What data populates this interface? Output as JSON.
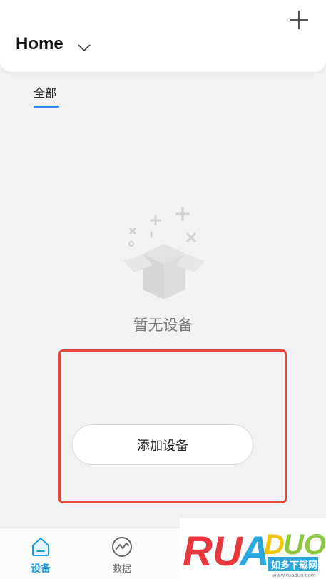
{
  "header": {
    "title": "Home"
  },
  "tabs": [
    {
      "label": "全部"
    }
  ],
  "empty_state": {
    "message": "暂无设备"
  },
  "actions": {
    "add_device_label": "添加设备"
  },
  "bottom_nav": {
    "items": [
      {
        "label": "设备",
        "icon": "home-icon",
        "active": true
      },
      {
        "label": "数据",
        "icon": "chart-pulse-icon",
        "active": false
      }
    ]
  },
  "watermark": {
    "brand": "RUADADUO",
    "tagline": "如多下载网",
    "url": "www.ruaduo.com"
  },
  "colors": {
    "accent": "#1e9be0",
    "tab_underline": "#2f8ae8",
    "highlight": "#e04b3a",
    "background": "#f1f2f4"
  }
}
